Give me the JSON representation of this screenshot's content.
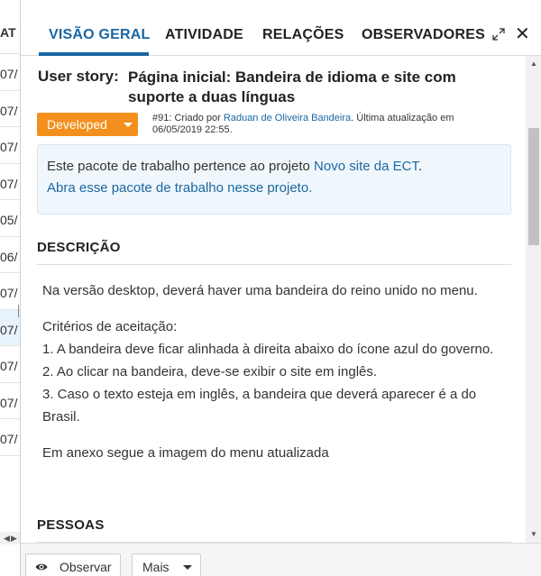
{
  "background_table": {
    "header": "AT",
    "rows": [
      "07/",
      "07/",
      "07/",
      "07/",
      "05/",
      "06/",
      "07/",
      "07/",
      "07/",
      "07/",
      "07/"
    ],
    "selected_row_index": 7
  },
  "tabs": [
    {
      "label": "VISÃO GERAL",
      "active": true
    },
    {
      "label": "ATIVIDADE",
      "active": false
    },
    {
      "label": "RELAÇÕES",
      "active": false
    },
    {
      "label": "OBSERVADORES",
      "active": false
    }
  ],
  "header_icons": {
    "expand": "expand-icon",
    "close": "✕"
  },
  "work_package": {
    "type": "User story:",
    "title": "Página inicial: Bandeira de idioma e site com suporte a duas línguas",
    "status": "Developed",
    "status_color": "#f3901d",
    "meta_prefix": "#91: Criado por ",
    "author": "Raduan de Oliveira Bandeira",
    "meta_suffix": ". Última atualização em 06/05/2019 22:55."
  },
  "notice": {
    "text": "Este pacote de trabalho pertence ao projeto ",
    "project_link": "Novo site da ECT",
    "text_end": ".",
    "open_link": "Abra esse pacote de trabalho nesse projeto."
  },
  "sections": {
    "description": "DESCRIÇÃO",
    "people": "PESSOAS"
  },
  "description": {
    "p1": "Na versão desktop, deverá haver uma bandeira do reino unido no menu.",
    "criteria_title": "Critérios de aceitação:",
    "criteria": [
      "1. A bandeira deve ficar alinhada à direita abaixo do ícone azul do governo.",
      "2. Ao clicar na bandeira, deve-se exibir o site em inglês.",
      "3. Caso o texto esteja em inglês, a bandeira que deverá aparecer é a do Brasil."
    ],
    "p3": "Em anexo segue a imagem do menu atualizada"
  },
  "footer": {
    "observe_label": "Observar",
    "more_label": "Mais"
  },
  "colors": {
    "accent": "#1a67a3",
    "status": "#f3901d",
    "notice_bg": "#f0f7fc"
  }
}
